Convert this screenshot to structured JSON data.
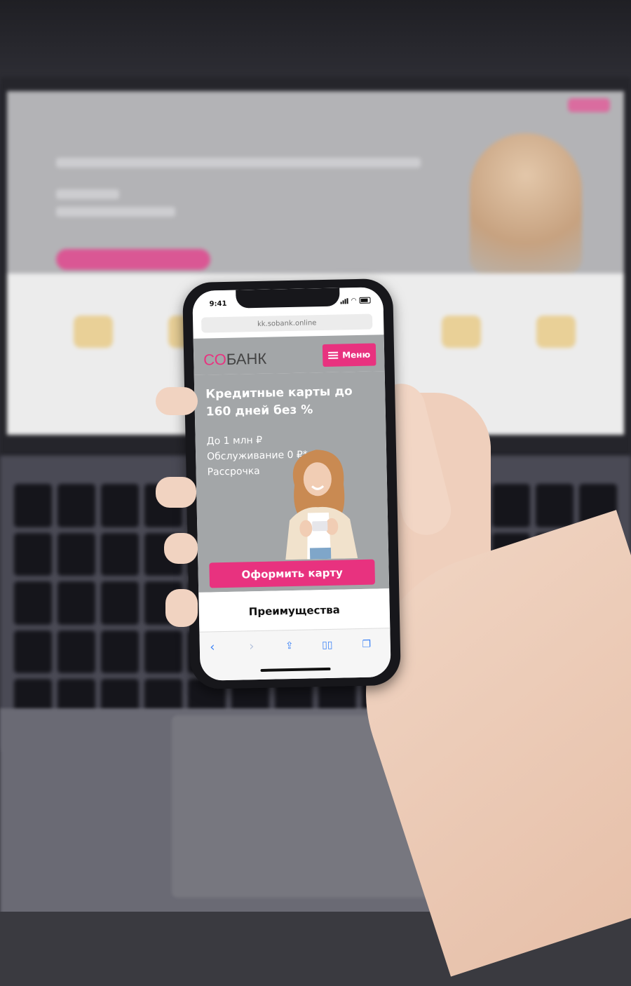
{
  "phone": {
    "status_time": "9:41",
    "url": "kk.sobank.online"
  },
  "site": {
    "logo_part1": "СО",
    "logo_part2": "БАНК",
    "menu_label": "Меню",
    "hero_title": "Кредитные карты до 160 дней без %",
    "features": [
      "До 1 млн ₽",
      "Обслуживание 0 ₽*",
      "Рассрочка"
    ],
    "cta_label": "Оформить карту",
    "section_title": "Преимущества"
  },
  "browser_toolbar": {
    "icons": [
      "back-icon",
      "forward-icon",
      "share-icon",
      "bookmarks-icon",
      "tabs-icon"
    ]
  },
  "colors": {
    "brand_pink": "#e8327f",
    "hero_gray": "#a3a6a8"
  }
}
